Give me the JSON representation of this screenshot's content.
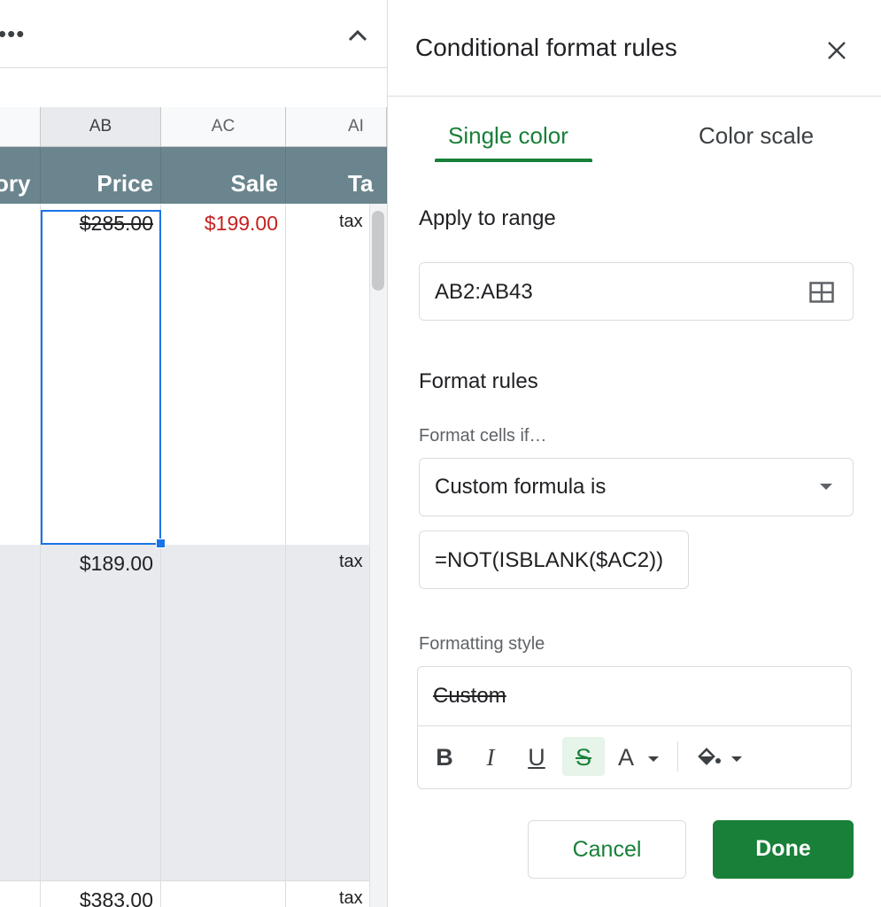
{
  "sheet": {
    "column_letters": [
      "",
      "AB",
      "AC",
      "AI"
    ],
    "header_labels": [
      "ory",
      "Price",
      "Sale",
      "Ta"
    ],
    "rows": [
      {
        "price": "$285.00",
        "sale": "$199.00",
        "tax": "tax"
      },
      {
        "price": "$189.00",
        "sale": "",
        "tax": "tax"
      },
      {
        "price": "$383.00",
        "sale": "",
        "tax": "tax"
      }
    ],
    "more_icon": "more-horizontal-icon",
    "collapse_icon": "chevron-up-icon"
  },
  "panel": {
    "title": "Conditional format rules",
    "close_icon": "close-icon",
    "tabs": [
      {
        "label": "Single color",
        "active": true
      },
      {
        "label": "Color scale",
        "active": false
      }
    ],
    "apply_to_range": {
      "title": "Apply to range",
      "value": "AB2:AB43",
      "icon": "select-range-grid-icon"
    },
    "format_rules": {
      "title": "Format rules",
      "condition_label": "Format cells if…",
      "condition_value": "Custom formula is",
      "formula_value": "=NOT(ISBLANK($AC2))"
    },
    "formatting_style": {
      "label": "Formatting style",
      "preview": "Custom",
      "tools": {
        "bold": "B",
        "italic": "I",
        "underline": "U",
        "strikethrough": "S",
        "text_color": "A",
        "fill_color_icon": "paint-bucket-icon"
      }
    },
    "buttons": {
      "cancel": "Cancel",
      "done": "Done"
    }
  },
  "colors": {
    "accent_green": "#188038",
    "header_row_bg": "#6b858e",
    "sale_red": "#c5221f",
    "selection_blue": "#1a73e8"
  }
}
